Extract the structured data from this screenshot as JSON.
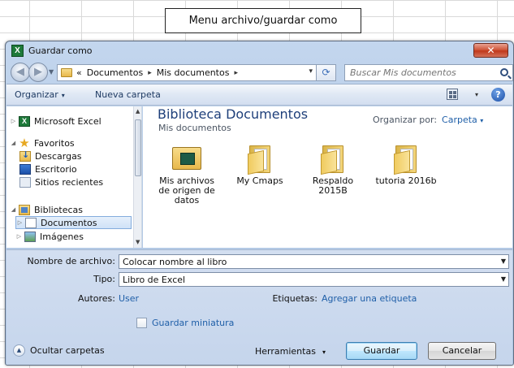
{
  "caption": "Menu archivo/guardar como",
  "window": {
    "title": "Guardar como",
    "app_icon_letter": "X",
    "close_glyph": "✕"
  },
  "address": {
    "prefix": "«",
    "crumbs": [
      "Documentos",
      "Mis documentos"
    ],
    "separator": "▸",
    "dropdown": "▾",
    "refresh_glyph": "⟳",
    "search_placeholder": "Buscar Mis documentos"
  },
  "toolbar": {
    "organize_label": "Organizar",
    "new_folder_label": "Nueva carpeta",
    "caret": "▾",
    "help_glyph": "?"
  },
  "nav": {
    "items": [
      {
        "label": "Microsoft Excel",
        "icon": "excel-icon",
        "tri": "▷"
      },
      {
        "label": "Favoritos",
        "icon": "star-icon",
        "tri": "◢"
      },
      {
        "label": "Descargas",
        "icon": "downloads-icon",
        "tri": ""
      },
      {
        "label": "Escritorio",
        "icon": "desktop-icon",
        "tri": ""
      },
      {
        "label": "Sitios recientes",
        "icon": "recent-places-icon",
        "tri": ""
      },
      {
        "label": "Bibliotecas",
        "icon": "libraries-icon",
        "tri": "◢"
      },
      {
        "label": "Documentos",
        "icon": "documents-icon",
        "tri": "▷",
        "selected": true
      },
      {
        "label": "Imágenes",
        "icon": "pictures-icon",
        "tri": "▷"
      }
    ]
  },
  "content": {
    "library_title": "Biblioteca Documentos",
    "library_subtitle": "Mis documentos",
    "arrange_label": "Organizar por:",
    "arrange_value": "Carpeta",
    "arrange_caret": "▾",
    "files": [
      {
        "name": "Mis archivos de origen de datos",
        "icon": "data-sources-folder-icon"
      },
      {
        "name": "My Cmaps",
        "icon": "folder-icon"
      },
      {
        "name": "Respaldo 2015B",
        "icon": "folder-icon"
      },
      {
        "name": "tutoria 2016b",
        "icon": "folder-icon"
      }
    ]
  },
  "form": {
    "filename_label": "Nombre de archivo:",
    "filename_value": "Colocar nombre al libro",
    "type_label": "Tipo:",
    "type_value": "Libro de Excel",
    "authors_label": "Autores:",
    "authors_value": "User",
    "tags_label": "Etiquetas:",
    "tags_value": "Agregar una etiqueta",
    "thumbnail_label": "Guardar miniatura",
    "thumbnail_checked": false
  },
  "footer": {
    "hide_folders_label": "Ocultar carpetas",
    "hide_glyph": "▲",
    "tools_label": "Herramientas",
    "tools_caret": "▾",
    "save_label": "Guardar",
    "cancel_label": "Cancelar"
  },
  "colors": {
    "accent": "#1e3f7a",
    "link": "#1f5fa8",
    "excel_green": "#1e7a3a",
    "close_red": "#c0391b"
  }
}
